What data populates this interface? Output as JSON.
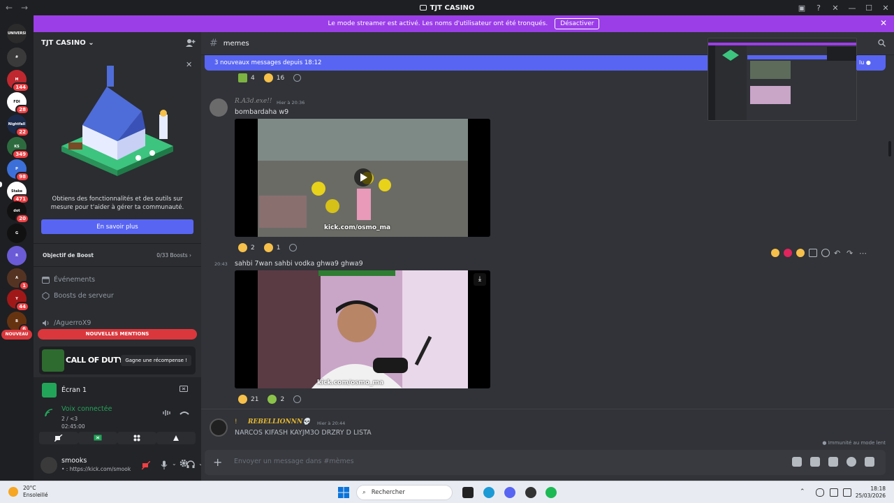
{
  "window": {
    "title": "TJT CASINO"
  },
  "banner": {
    "text": "Le mode streamer est activé. Les noms d'utilisateur ont été tronqués.",
    "button": "Désactiver"
  },
  "rail": {
    "servers": [
      {
        "label": "UNIVERSE",
        "badge": "",
        "color": "#2b2b2b"
      },
      {
        "label": "#",
        "badge": "",
        "color": "#3a3a3a"
      },
      {
        "label": "M",
        "badge": "144",
        "color": "#c0282f"
      },
      {
        "label": "FDI",
        "badge": "28",
        "color": "#ffffff"
      },
      {
        "label": "Nightfall",
        "badge": "22",
        "color": "#1b2a4a"
      },
      {
        "label": "KS",
        "badge": "349",
        "color": "#2d6b3f"
      },
      {
        "label": "P",
        "badge": "98",
        "color": "#3c6fd8"
      },
      {
        "label": "Stake",
        "badge": "471",
        "color": "#ffffff"
      },
      {
        "label": "dot",
        "badge": "20",
        "color": "#111111"
      },
      {
        "label": "G",
        "badge": "",
        "color": "#111111"
      },
      {
        "label": "R",
        "badge": "",
        "color": "#6b5bd6"
      },
      {
        "label": "A",
        "badge": "1",
        "color": "#553322"
      },
      {
        "label": "Y",
        "badge": "44",
        "color": "#a01818"
      },
      {
        "label": "B",
        "badge": "6",
        "color": "#663311"
      }
    ],
    "new_label": "NOUVEAU"
  },
  "sidebar": {
    "server_name": "TJT CASINO",
    "promo_text": "Obtiens des fonctionnalités et des outils sur mesure pour t'aider à gérer ta communauté.",
    "learn_more": "En savoir plus",
    "boost_label": "Objectif de Boost",
    "boost_count": "0/33 Boosts",
    "nav": [
      {
        "label": "Événements"
      },
      {
        "label": "Boosts de serveur"
      },
      {
        "label": "/AguerroX9"
      }
    ],
    "mentions": "NOUVELLES MENTIONS",
    "ad": {
      "logo": "CALL OF DUTY",
      "button": "Gagne une récompense !"
    },
    "voice": {
      "screen": "Écran 1",
      "status": "Voix connectée",
      "channel": "2 / <3",
      "timer": "02:45:00"
    },
    "user": {
      "name": "smooks",
      "status": "• : https://kick.com/smook"
    }
  },
  "main": {
    "channel": "memes",
    "new_messages": "3 nouveaux messages depuis 18:12",
    "top_reactions": [
      {
        "count": "4",
        "color": "#7cb342"
      },
      {
        "count": "16",
        "color": "#f6c04a"
      }
    ],
    "messages": [
      {
        "author": "R.A3d.exe!!",
        "time": "Hier à 20:36",
        "text": "bombardaha w9",
        "video_watermark": "kick.com/osmo_ma",
        "reactions": [
          {
            "count": "2",
            "color": "#f6c04a"
          },
          {
            "count": "1",
            "color": "#f6c04a"
          }
        ]
      },
      {
        "time_short": "20:43",
        "text": "sahbi 7wan sahbi vodka ghwa9 ghwa9",
        "video_watermark": "kick.com/osmo_ma",
        "reactions": [
          {
            "count": "21",
            "color": "#f6c04a"
          },
          {
            "count": "2",
            "color": "#8bc34a"
          }
        ]
      },
      {
        "author_prefix": "!",
        "author": "REBELLIONNN💀",
        "time": "Hier à 20:44",
        "text": "NARCOS KIFASH KAYJM3O DRZRY D LISTA"
      }
    ],
    "immunity": "Immunité au mode lent",
    "composer_placeholder": "Envoyer un message dans #mèmes",
    "pip_button": "lu"
  },
  "taskbar": {
    "temp": "20°C",
    "weather": "Ensoleillé",
    "search": "Rechercher",
    "time": "18:18",
    "date": "25/03/2026"
  }
}
